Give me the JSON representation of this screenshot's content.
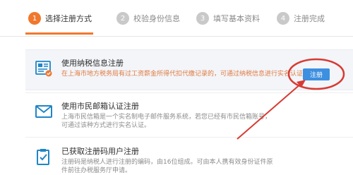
{
  "steps": [
    {
      "number": "1",
      "label": "选择注册方式"
    },
    {
      "number": "2",
      "label": "校验身份信息"
    },
    {
      "number": "3",
      "label": "填写基本资料"
    },
    {
      "number": "4",
      "label": "注册完成"
    }
  ],
  "options": [
    {
      "title": "使用纳税信息注册",
      "description": "在上海市地方税务局有过工资薪金所得代扣代缴记录的，可通过纳税信息进行实名认证。",
      "icon": "tax-card-icon"
    },
    {
      "title": "使用市民邮箱认证注册",
      "description": "上海市民信箱是一个实名制电子邮件服务系统，若您已经有市民信箱账号，可通过该种方式进行实名认证。",
      "icon": "mail-icon"
    },
    {
      "title": "已获取注册码用户注册",
      "description": "注册码是纳税人进行注册的编码，由16位组成。可由本人携有效身份证件原件前往办税服务厅申请。",
      "icon": "clipboard-check-icon"
    }
  ],
  "register_button": "注册",
  "colors": {
    "active_step": "#f0782e",
    "button": "#3d8fe0",
    "annotation": "#d83a32",
    "highlight_text": "#e07a3f"
  }
}
